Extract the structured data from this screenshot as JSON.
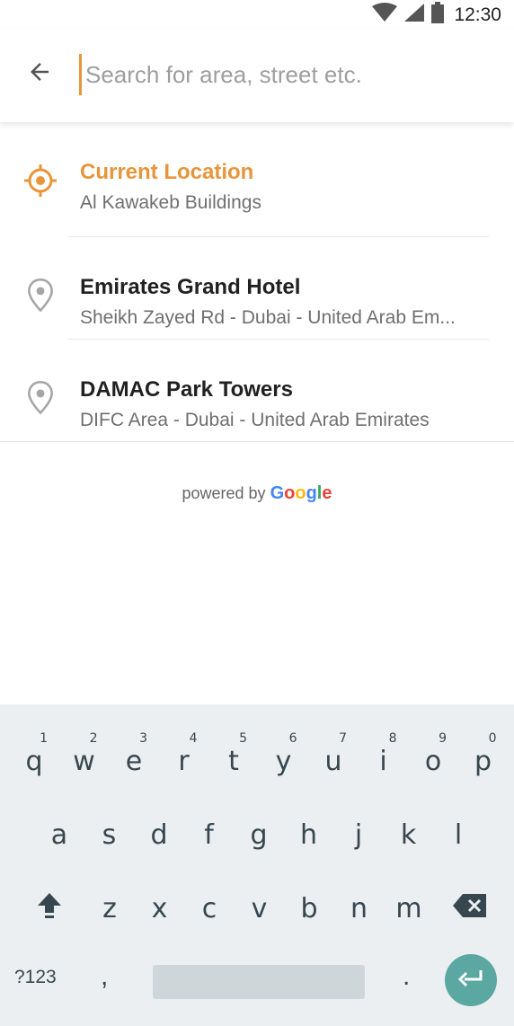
{
  "status_bar": {
    "time": "12:30",
    "icons": [
      "wifi-icon",
      "signal-icon",
      "battery-icon"
    ]
  },
  "search": {
    "placeholder": "Search for area, street etc.",
    "value": ""
  },
  "results": [
    {
      "title": "Current Location",
      "subtitle": "Al Kawakeb Buildings",
      "icon": "crosshair-icon"
    },
    {
      "title": "Emirates Grand Hotel",
      "subtitle": "Sheikh Zayed Rd - Dubai - United Arab Em...",
      "icon": "location-pin-icon"
    },
    {
      "title": "DAMAC Park Towers",
      "subtitle": "DIFC Area - Dubai - United Arab Emirates",
      "icon": "location-pin-icon"
    }
  ],
  "attribution": {
    "prefix": "powered by",
    "brand_letters": [
      "G",
      "o",
      "o",
      "g",
      "l",
      "e"
    ]
  },
  "keyboard": {
    "row1": [
      {
        "k": "q",
        "n": "1"
      },
      {
        "k": "w",
        "n": "2"
      },
      {
        "k": "e",
        "n": "3"
      },
      {
        "k": "r",
        "n": "4"
      },
      {
        "k": "t",
        "n": "5"
      },
      {
        "k": "y",
        "n": "6"
      },
      {
        "k": "u",
        "n": "7"
      },
      {
        "k": "i",
        "n": "8"
      },
      {
        "k": "o",
        "n": "9"
      },
      {
        "k": "p",
        "n": "0"
      }
    ],
    "row2": [
      "a",
      "s",
      "d",
      "f",
      "g",
      "h",
      "j",
      "k",
      "l"
    ],
    "row3": [
      "z",
      "x",
      "c",
      "v",
      "b",
      "n",
      "m"
    ],
    "symbols_label": "?123",
    "comma": ",",
    "period": "."
  },
  "colors": {
    "accent": "#e8953a",
    "google_blue": "#4285f4",
    "google_red": "#ea4335",
    "google_yellow": "#fbbc05",
    "google_green": "#34a853",
    "enter_key": "#5ba8a3"
  }
}
